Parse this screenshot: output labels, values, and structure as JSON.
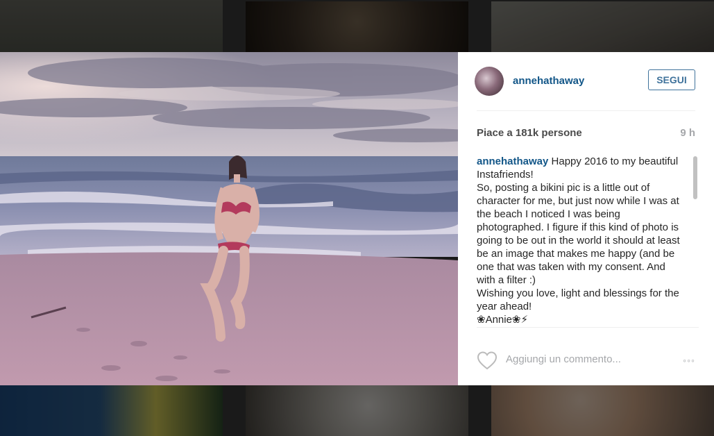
{
  "post": {
    "username": "annehathaway",
    "follow_label": "SEGUI",
    "likes_text": "Piace a 181k persone",
    "time_ago": "9 h",
    "caption": {
      "author": "annehathaway",
      "lines": [
        " Happy 2016 to my beautiful Instafriends!",
        "So, posting a bikini pic is a little out of character for me, but just now while I was at the beach I noticed I was being photographed. I figure if this kind of photo is going to be out in the world it should at least be an image that makes me happy (and be one that was taken with my consent. And with a filter :)",
        "Wishing you love, light and blessings for the year ahead!",
        "❀Annie❀⚡"
      ]
    },
    "comment_placeholder": "Aggiungi un commento...",
    "more_label": "◦◦◦"
  },
  "icons": {
    "like": "heart-icon",
    "more": "more-options-icon"
  },
  "colors": {
    "username": "#125688",
    "follow_border": "#3f729b",
    "meta_grey": "#a5a7aa"
  }
}
